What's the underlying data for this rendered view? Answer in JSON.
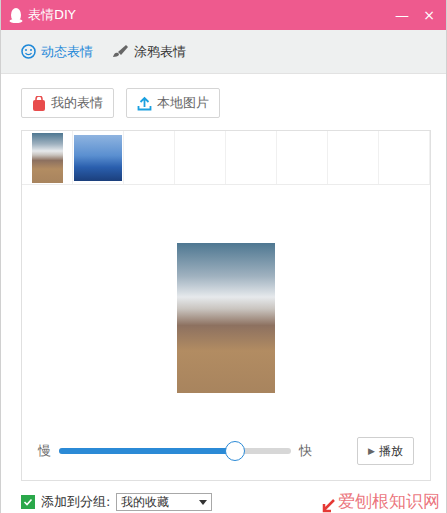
{
  "window": {
    "title": "表情DIY",
    "controls": [
      "—",
      "×"
    ]
  },
  "tabs": [
    {
      "label": "动态表情",
      "selected": true
    },
    {
      "label": "涂鸦表情",
      "selected": false
    }
  ],
  "buttons": [
    {
      "label": "我的表情",
      "kind": "bag"
    },
    {
      "label": "本地图片",
      "kind": "upload"
    }
  ],
  "thumbnails": [
    {
      "kind": "mountain"
    },
    {
      "kind": "bridge"
    }
  ],
  "preview": {
    "kind": "mountain"
  },
  "speed": {
    "slow": "慢",
    "fast": "快",
    "level": 0.76
  },
  "play_button": {
    "icon": "▶",
    "label": "播放"
  },
  "group": {
    "checked": true,
    "label": "添加到分组:",
    "value": "我的收藏"
  },
  "watermark": "爱刨根知识网"
}
